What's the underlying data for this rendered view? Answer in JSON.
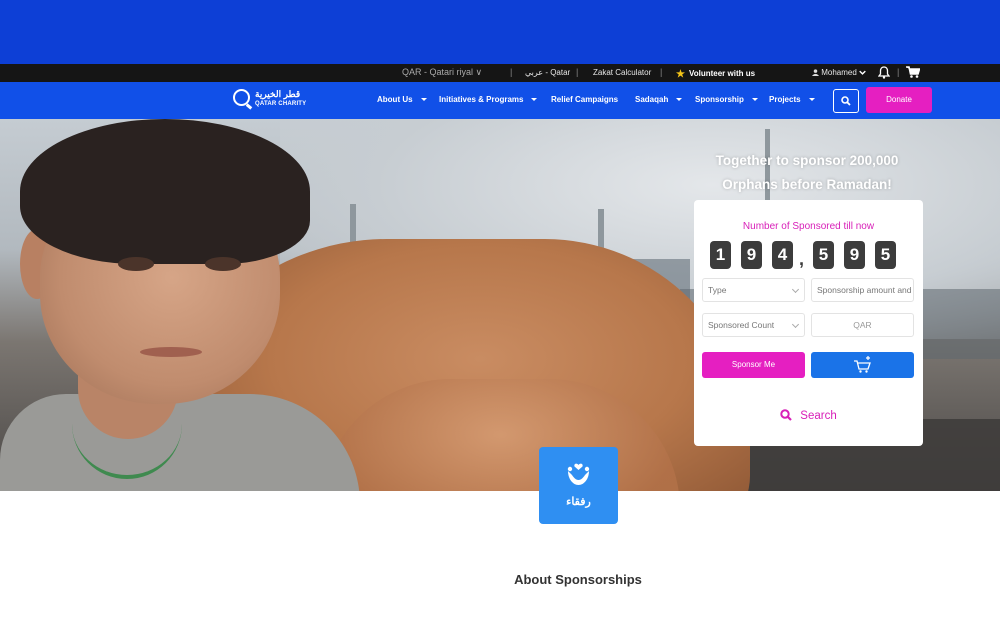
{
  "utility_bar": {
    "currency": "QAR - Qatari riyal",
    "language": "عربي - Qatar",
    "zakat_calculator": "Zakat Calculator",
    "volunteer": "Volunteer with us",
    "user": "Mohamed"
  },
  "nav": {
    "logo_arabic": "قطر الخيرية",
    "logo_english": "QATAR CHARITY",
    "items": [
      {
        "label": "About Us"
      },
      {
        "label": "Initiatives & Programs"
      },
      {
        "label": "Relief Campaigns"
      },
      {
        "label": "Sadaqah"
      },
      {
        "label": "Sponsorship"
      },
      {
        "label": "Projects"
      }
    ],
    "donate": "Donate"
  },
  "hero": {
    "title_line1": "Together to sponsor 200,000",
    "title_line2": "Orphans before Ramadan!"
  },
  "sponsor_card": {
    "title": "Number of Sponsored till now",
    "counter_digits": [
      "1",
      "9",
      "4",
      "5",
      "9",
      "5"
    ],
    "type_placeholder": "Type",
    "amount_placeholder": "Sponsorship amount and",
    "count_placeholder": "Sponsored Count",
    "currency_field": "QAR",
    "sponsor_button": "Sponsor Me",
    "search_label": "Search"
  },
  "badge": {
    "text": "رفقاء"
  },
  "section": {
    "about_title": "About Sponsorships"
  },
  "colors": {
    "top_band": "#0d3fd6",
    "nav_blue": "#1150e8",
    "magenta": "#e51fc1",
    "button_blue": "#1a73e8",
    "badge_blue": "#2f8ff2"
  }
}
